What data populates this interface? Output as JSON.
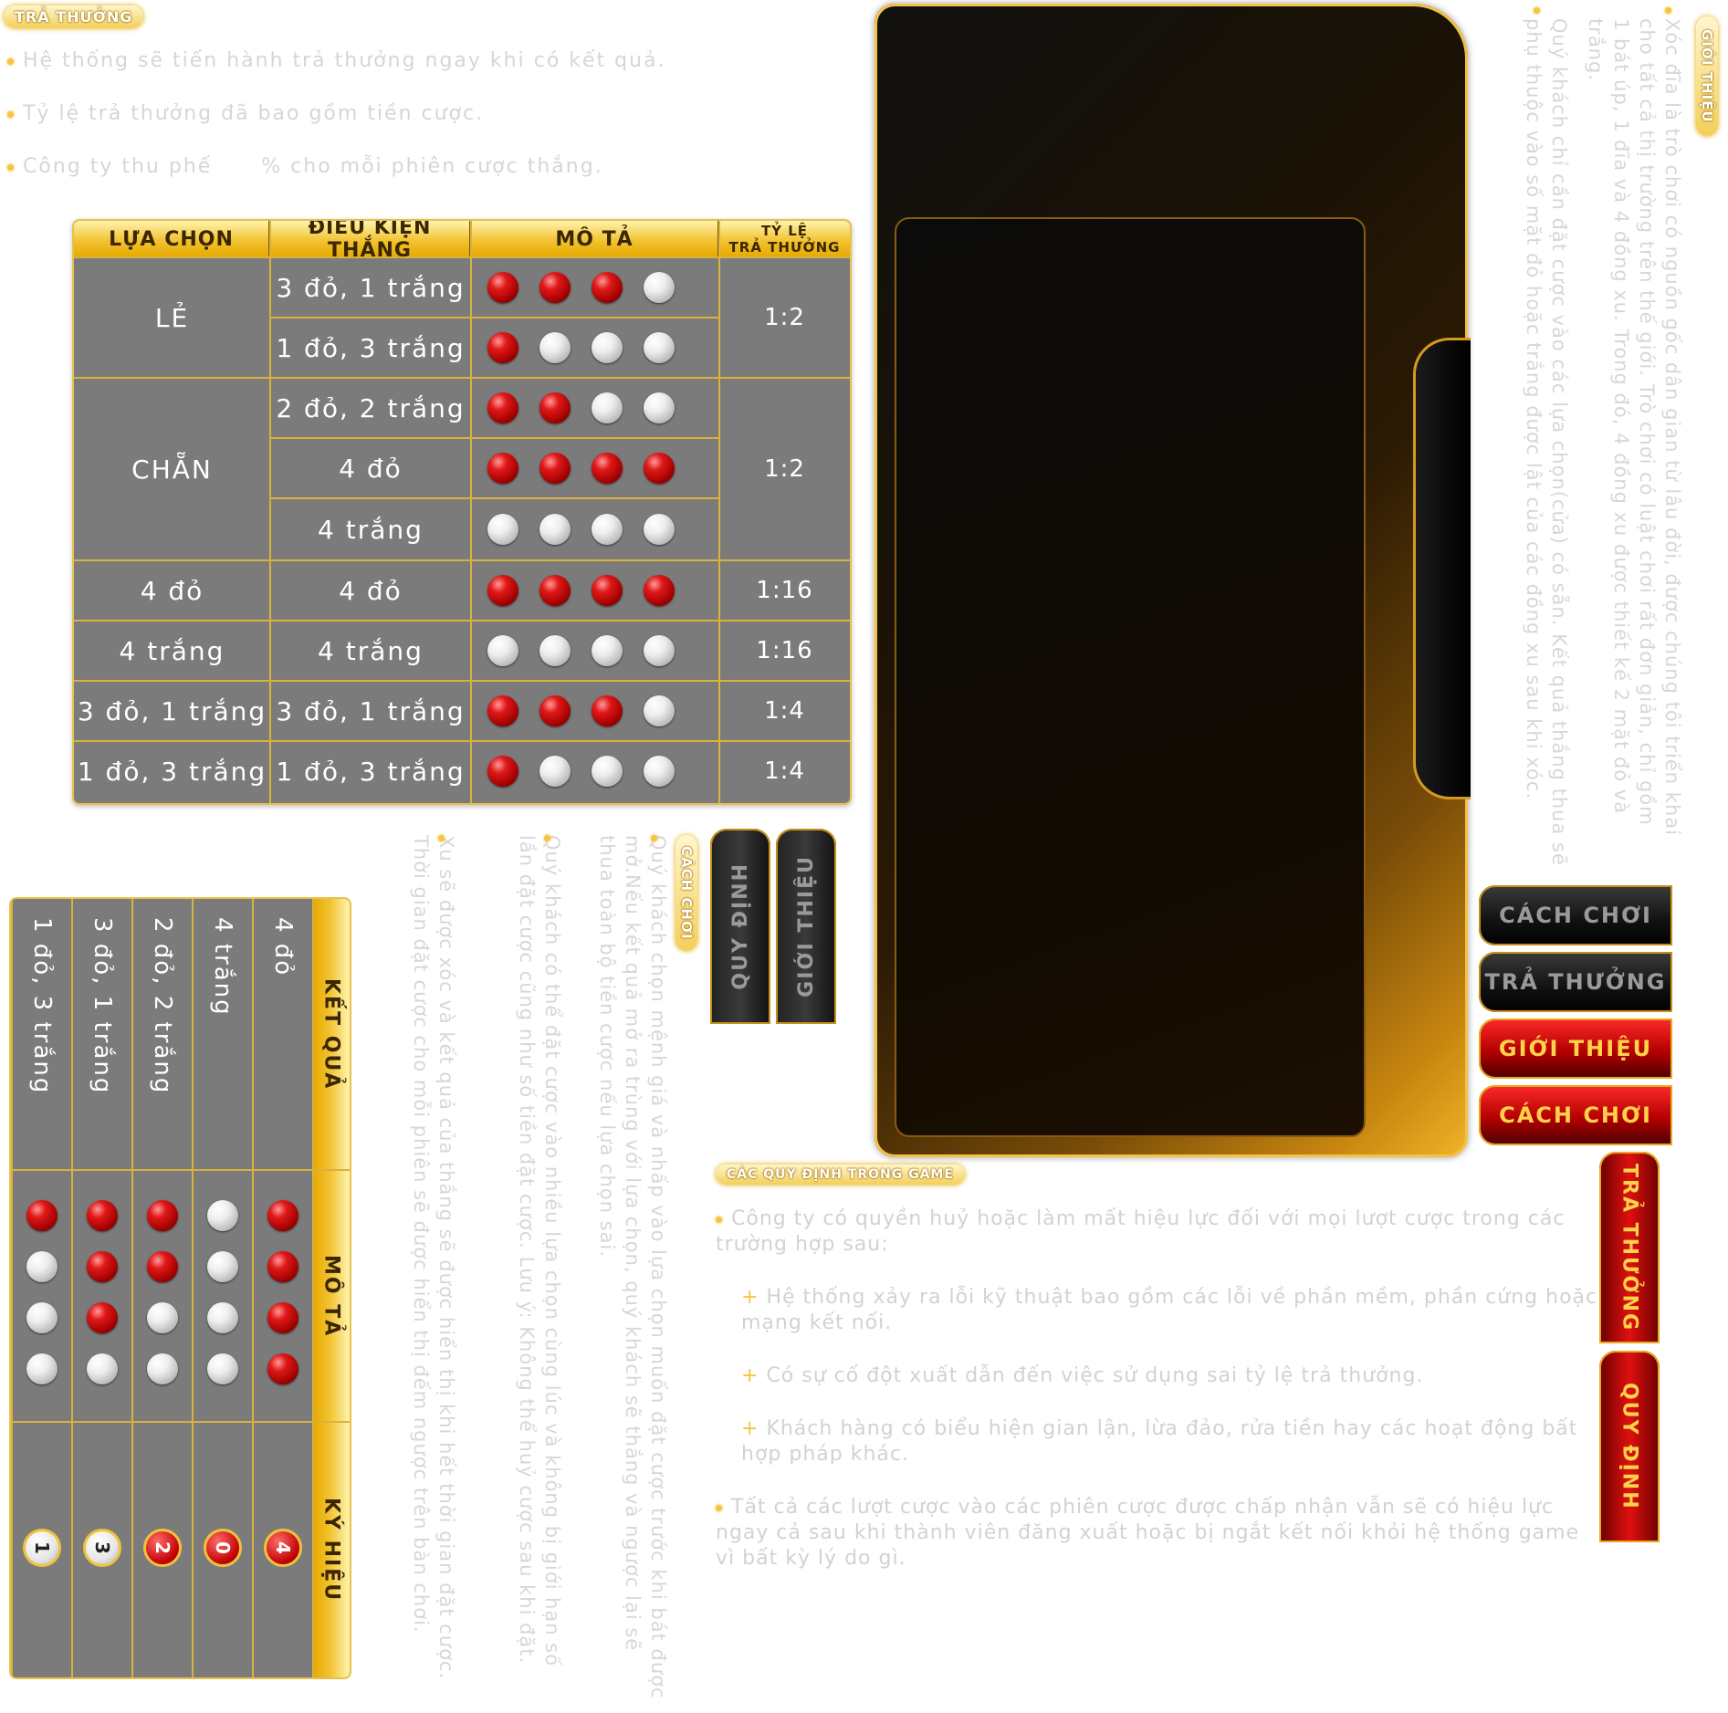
{
  "tra_thuong": {
    "title": "TRẢ THƯỞNG",
    "notes": [
      "Hệ thống sẽ tiến hành trả thưởng ngay khi có kết quả.",
      "Tỷ lệ trả thưởng đã bao gồm tiền cược.",
      "Công ty thu phế      % cho mỗi phiên cược thắng."
    ]
  },
  "payout_table": {
    "headers": [
      "LỰA CHỌN",
      "ĐIỀU KIỆN THẮNG",
      "MÔ TẢ",
      "TỶ LỆ",
      "TRẢ THƯỞNG"
    ],
    "rows": [
      {
        "choice": "LẺ",
        "condition": "3 đỏ, 1 trắng",
        "balls": [
          "red",
          "red",
          "red",
          "white"
        ],
        "ratio": "1:2"
      },
      {
        "choice": "",
        "condition": "1 đỏ, 3 trắng",
        "balls": [
          "red",
          "white",
          "white",
          "white"
        ],
        "ratio": ""
      },
      {
        "choice": "CHẴN",
        "condition": "2 đỏ, 2 trắng",
        "balls": [
          "red",
          "red",
          "white",
          "white"
        ],
        "ratio": "1:2"
      },
      {
        "choice": "",
        "condition": "4 đỏ",
        "balls": [
          "red",
          "red",
          "red",
          "red"
        ],
        "ratio": ""
      },
      {
        "choice": "",
        "condition": "4 trắng",
        "balls": [
          "white",
          "white",
          "white",
          "white"
        ],
        "ratio": ""
      },
      {
        "choice": "4 đỏ",
        "condition": "4 đỏ",
        "balls": [
          "red",
          "red",
          "red",
          "red"
        ],
        "ratio": "1:16"
      },
      {
        "choice": "4 trắng",
        "condition": "4 trắng",
        "balls": [
          "white",
          "white",
          "white",
          "white"
        ],
        "ratio": "1:16"
      },
      {
        "choice": "3 đỏ, 1 trắng",
        "condition": "3 đỏ, 1 trắng",
        "balls": [
          "red",
          "red",
          "red",
          "white"
        ],
        "ratio": "1:4"
      },
      {
        "choice": "1 đỏ, 3 trắng",
        "condition": "1 đỏ, 3 trắng",
        "balls": [
          "red",
          "white",
          "white",
          "white"
        ],
        "ratio": "1:4"
      }
    ]
  },
  "result_table": {
    "headers": [
      "KẾT QUẢ",
      "MÔ TẢ",
      "KÝ HIỆU"
    ],
    "rows": [
      {
        "result": "4 đỏ",
        "balls": [
          "red",
          "red",
          "red",
          "red"
        ],
        "symbol": "4",
        "symbol_color": "red"
      },
      {
        "result": "4 trắng",
        "balls": [
          "white",
          "white",
          "white",
          "white"
        ],
        "symbol": "0",
        "symbol_color": "red"
      },
      {
        "result": "2 đỏ, 2 trắng",
        "balls": [
          "red",
          "red",
          "white",
          "white"
        ],
        "symbol": "2",
        "symbol_color": "red"
      },
      {
        "result": "3 đỏ, 1 trắng",
        "balls": [
          "red",
          "red",
          "red",
          "white"
        ],
        "symbol": "3",
        "symbol_color": "white"
      },
      {
        "result": "1 đỏ, 3 trắng",
        "balls": [
          "red",
          "white",
          "white",
          "white"
        ],
        "symbol": "1",
        "symbol_color": "white"
      }
    ]
  },
  "gioi_thieu": {
    "title": "GIỚI THIỆU",
    "p1": "Xóc đĩa là trò chơi có nguồn gốc dân gian từ lâu đời, được chúng tôi triển khai cho tất cả thị trường trên thế giới. Trò chơi có luật chơi rất đơn giản, chỉ gồm 1 bát úp, 1 đĩa và 4 đồng xu. Trong đó, 4 đồng xu được thiết kế 2 mặt đỏ và trắng.",
    "p2": "Quý khách chỉ cần đặt cược vào các lựa chọn(cửa) có sẵn. Kết quả thắng thua sẽ phụ thuộc vào số mặt đỏ hoặc trắng được lật của các đồng xu sau khi xóc."
  },
  "cach_choi": {
    "title": "CÁCH CHƠI",
    "p1": "Quý khách chọn mệnh giá và nhấp vào lựa chọn muốn đặt cược trước khi bát được mở.Nếu kết quả mở ra trùng với lựa chọn, quý khách sẽ thắng và ngược lại sẽ thua toàn bộ tiền cược nếu lựa chọn sai.",
    "p2": "Quý khách có thể đặt cược vào nhiều lựa chọn cùng lúc và không bị giới hạn số lần đặt cược cũng như số tiền đặt cược. Lưu ý: Không thể huỷ cược sau khi đặt.",
    "p3": "Xu sẽ được xóc và kết quả của thắng sẽ được hiển thị khi hết thời gian đặt cược. Thời gian đặt cược cho mỗi phiên sẽ được hiển thị đếm ngược trên bàn chơi."
  },
  "quy_dinh": {
    "title": "CÁC QUY ĐỊNH TRONG GAME",
    "intro": "Công ty có quyền huỷ hoặc làm mất hiệu lực đối với mọi lượt cược trong các trường hợp sau:",
    "cases": [
      "Hệ thống xảy ra lỗi kỹ thuật bao gồm các lỗi về phần mềm, phần cứng hoặc mạng kết nối.",
      "Có sự cố đột xuất dẫn đến việc sử dụng sai tỷ lệ trả thưởng.",
      "Khách hàng có biểu hiện gian lận, lừa đảo, rửa tiền hay các hoạt động bất hợp pháp khác."
    ],
    "outro": "Tất cả các lượt cược vào các phiên cược được chấp nhận vẫn sẽ có hiệu lực ngay cả sau khi thành viên đăng xuất hoặc bị ngắt kết nối khỏi hệ thống game vì bất kỳ lý do gì."
  },
  "tabs_horizontal": [
    {
      "label": "CÁCH CHƠI",
      "style": "dark"
    },
    {
      "label": "TRẢ THƯỞNG",
      "style": "dark"
    },
    {
      "label": "GIỚI THIỆU",
      "style": "red"
    },
    {
      "label": "CÁCH CHƠI",
      "style": "red"
    }
  ],
  "tabs_vertical_dark": [
    "QUY ĐỊNH",
    "GIỚI THIỆU"
  ],
  "tabs_vertical_red": [
    "TRẢ THƯỞNG",
    "QUY ĐỊNH"
  ],
  "colors": {
    "gold": "#f2c230",
    "red_ball": "#d81818",
    "table_bg": "#7b7b7b"
  }
}
